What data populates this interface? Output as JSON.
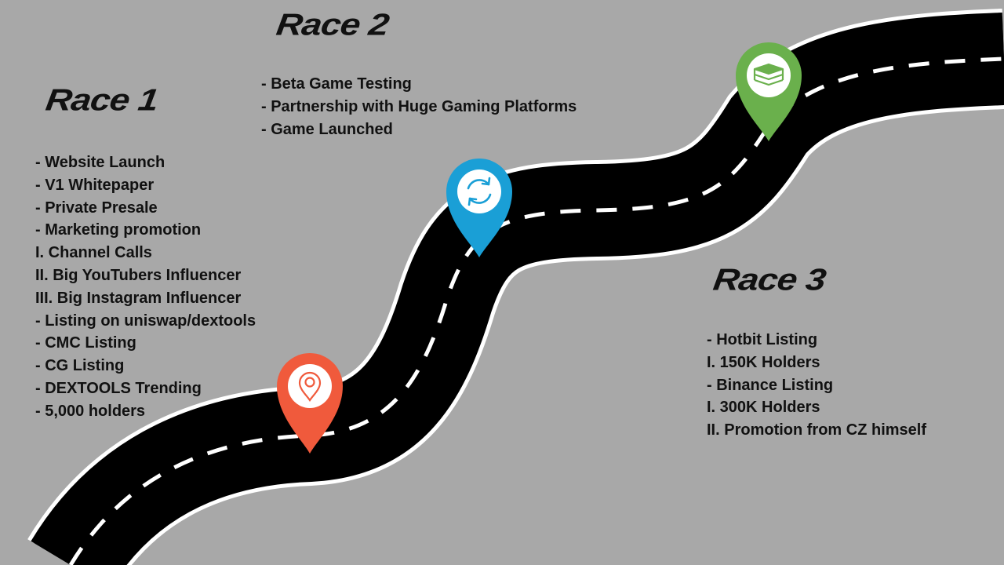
{
  "colors": {
    "background": "#a8a8a8",
    "road": "#000000",
    "road_edge": "#ffffff",
    "pin_red": "#f05a3c",
    "pin_blue": "#1a9fd6",
    "pin_green": "#6ab04c"
  },
  "races": [
    {
      "title": "Race 1",
      "pin_icon": "location-pin-icon",
      "items": [
        "- Website Launch",
        "- V1 Whitepaper",
        "- Private Presale",
        "- Marketing promotion",
        "I. Channel Calls",
        "II. Big YouTubers Influencer",
        "III. Big Instagram Influencer",
        "- Listing on uniswap/dextools",
        "- CMC Listing",
        "- CG Listing",
        "- DEXTOOLS Trending",
        "- 5,000 holders"
      ]
    },
    {
      "title": "Race 2",
      "pin_icon": "refresh-icon",
      "items": [
        "- Beta Game Testing",
        "- Partnership with Huge Gaming Platforms",
        "- Game Launched"
      ]
    },
    {
      "title": "Race 3",
      "pin_icon": "layers-icon",
      "items": [
        "- Hotbit Listing",
        "I. 150K Holders",
        "- Binance Listing",
        "I. 300K Holders",
        "II. Promotion from CZ himself"
      ]
    }
  ]
}
